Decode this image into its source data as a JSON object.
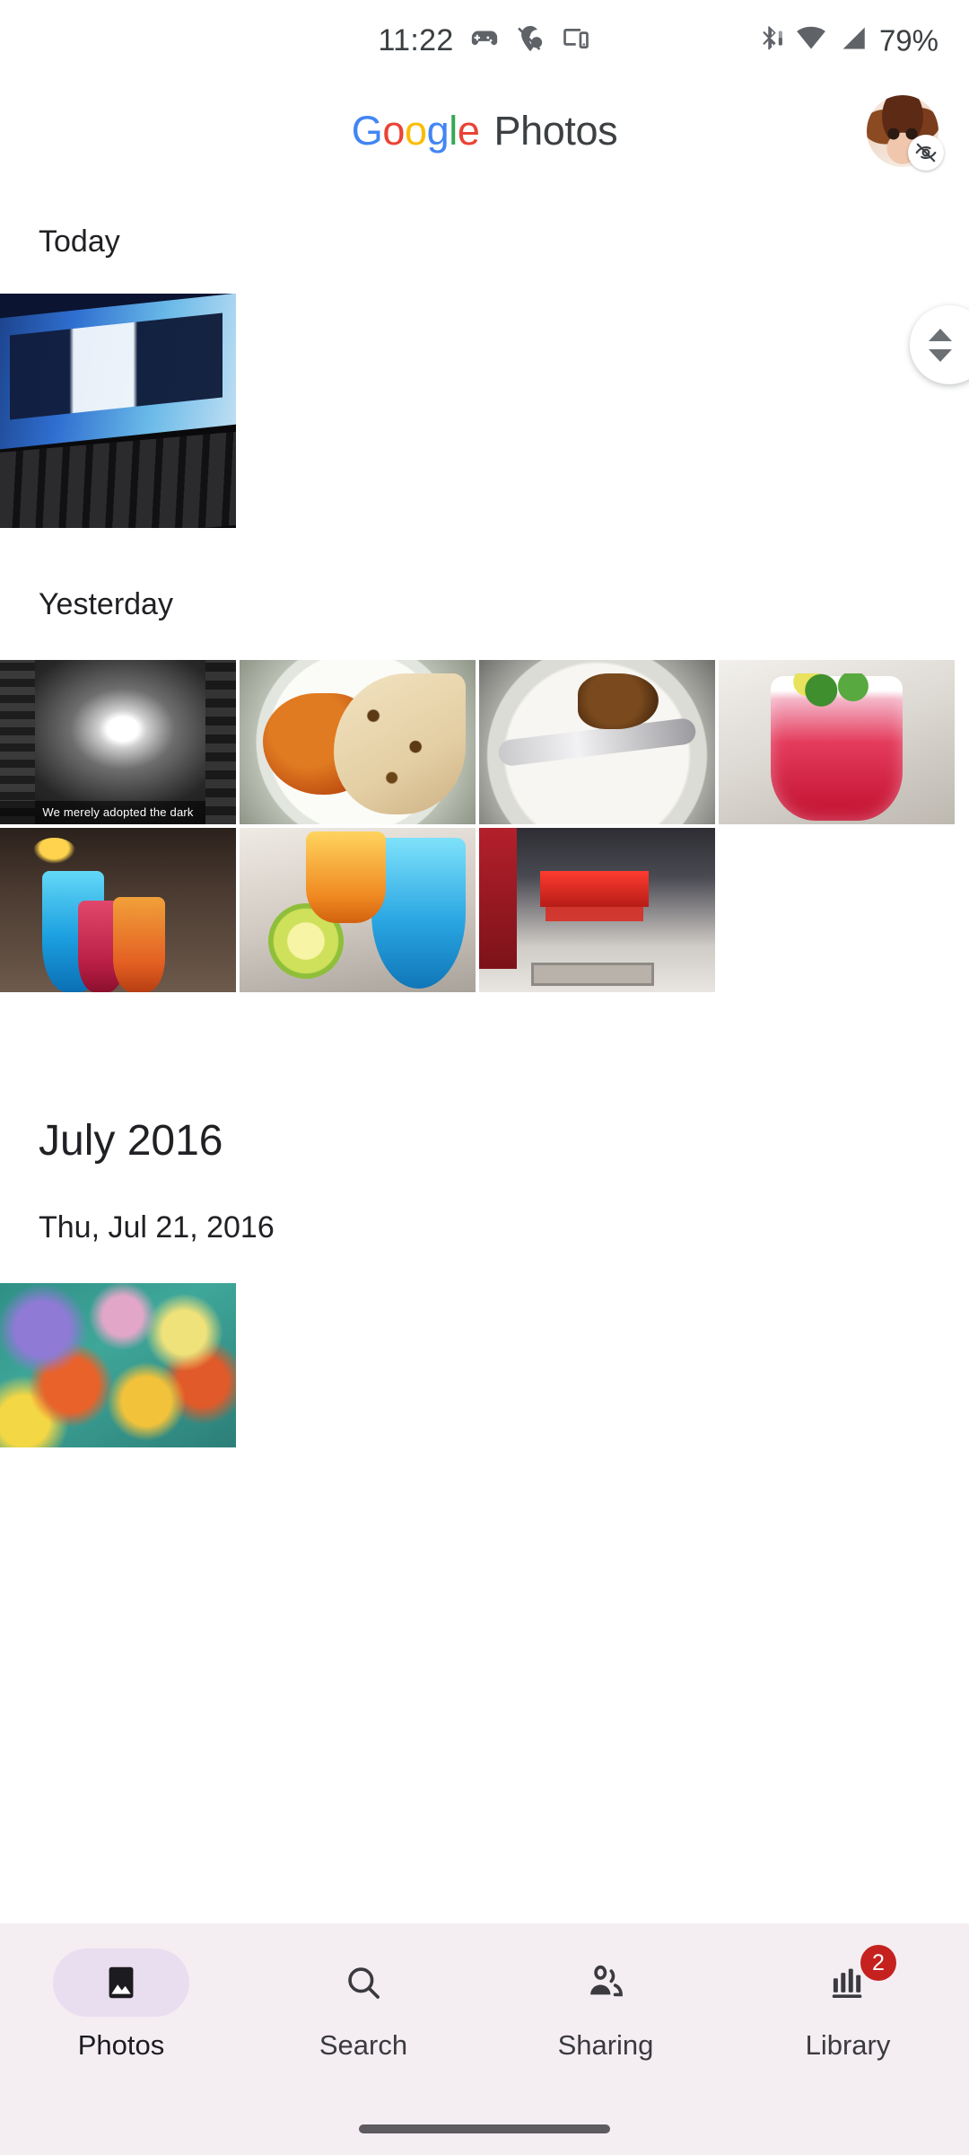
{
  "status_bar": {
    "clock": "11:22",
    "battery": "79%",
    "icons": [
      {
        "name": "game-controller-icon"
      },
      {
        "name": "location-off-icon"
      },
      {
        "name": "cast-device-icon"
      }
    ],
    "right_icons": [
      {
        "name": "bluetooth-icon"
      },
      {
        "name": "wifi-icon"
      },
      {
        "name": "cellular-signal-icon"
      }
    ]
  },
  "header": {
    "brand_google": [
      "G",
      "o",
      "o",
      "g",
      "l",
      "e"
    ],
    "brand_app": "Photos",
    "avatar_name": "account-avatar",
    "avatar_badge_name": "backup-off-badge",
    "colors": {
      "blue": "#4285F4",
      "red": "#EA4335",
      "yellow": "#FBBC05",
      "green": "#34A853",
      "text": "#3c4043"
    }
  },
  "scrollbar": {
    "name": "fast-scroll-thumb",
    "up_icon": "chevron-up-icon",
    "down_icon": "chevron-down-icon"
  },
  "sections": [
    {
      "id": "today",
      "header": "Today",
      "photos": [
        {
          "name": "photo-laptop-desktop",
          "caption": null,
          "art": "t-laptop",
          "tall": true
        }
      ]
    },
    {
      "id": "yesterday",
      "header": "Yesterday",
      "photos": [
        {
          "name": "photo-dark-corridor",
          "caption": "We merely adopted the dark",
          "art": "t-corridor"
        },
        {
          "name": "photo-curry-roti-plate",
          "caption": null,
          "art": "t-food"
        },
        {
          "name": "photo-finished-plate",
          "caption": null,
          "art": "t-plate2"
        },
        {
          "name": "photo-red-mocktail",
          "caption": null,
          "art": "t-mocktail"
        },
        {
          "name": "photo-three-drinks",
          "caption": null,
          "art": "t-drinks"
        },
        {
          "name": "photo-colorful-glasses",
          "caption": null,
          "art": "t-glasses"
        },
        {
          "name": "photo-mall-entrance",
          "caption": null,
          "art": "t-mall"
        }
      ]
    },
    {
      "id": "july-2016",
      "month_header": "July 2016",
      "date_header": "Thu, Jul 21, 2016",
      "photos": [
        {
          "name": "photo-abstract-painting",
          "caption": null,
          "art": "t-abstract"
        }
      ]
    }
  ],
  "bottom_nav": {
    "items": [
      {
        "label": "Photos",
        "icon": "photos-icon",
        "active": true,
        "badge": null
      },
      {
        "label": "Search",
        "icon": "search-icon",
        "active": false,
        "badge": null
      },
      {
        "label": "Sharing",
        "icon": "sharing-icon",
        "active": false,
        "badge": null
      },
      {
        "label": "Library",
        "icon": "library-icon",
        "active": false,
        "badge": "2"
      }
    ],
    "badge_color": "#c5221f",
    "active_pill_color": "#e9ddf0",
    "background": "#f4eef3"
  },
  "gesture_bar": {
    "name": "home-gesture-pill"
  }
}
